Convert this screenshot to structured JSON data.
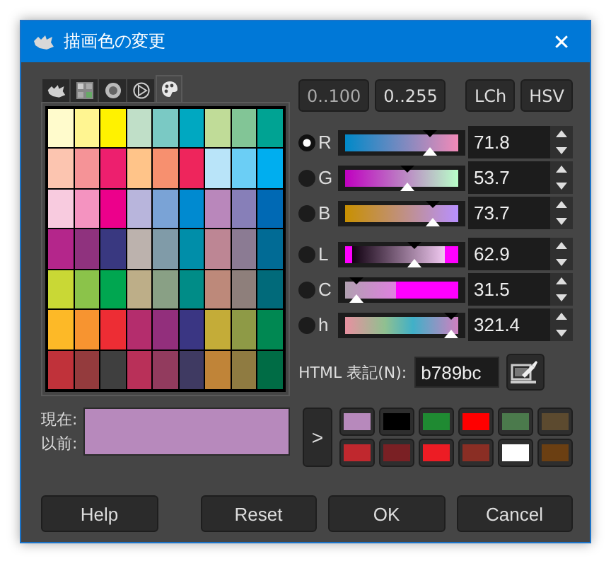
{
  "window": {
    "title": "描画色の変更",
    "close": "✕"
  },
  "selector_tabs": [
    {
      "selected": false
    },
    {
      "selected": false
    },
    {
      "selected": false
    },
    {
      "selected": false
    },
    {
      "selected": true
    }
  ],
  "palette": [
    {
      "color": "#fffbcc"
    },
    {
      "color": "#fff591"
    },
    {
      "color": "#fff200"
    },
    {
      "color": "#c0dfc8"
    },
    {
      "color": "#7ac9c4"
    },
    {
      "color": "#00a8c1"
    },
    {
      "color": "#c0dc98"
    },
    {
      "color": "#82c596"
    },
    {
      "color": "#00a393"
    },
    {
      "color": "#fcc5b0"
    },
    {
      "color": "#f59397"
    },
    {
      "color": "#ed1f6e"
    },
    {
      "color": "#ffc489"
    },
    {
      "color": "#f7906f"
    },
    {
      "color": "#ee255c"
    },
    {
      "color": "#b9e4f9"
    },
    {
      "color": "#6bcef5"
    },
    {
      "color": "#00aeef"
    },
    {
      "color": "#f8cbdf"
    },
    {
      "color": "#f493c0"
    },
    {
      "color": "#ec008b"
    },
    {
      "color": "#b8b5dc"
    },
    {
      "color": "#7aa3d6"
    },
    {
      "color": "#008ad0"
    },
    {
      "color": "#b987bb"
    },
    {
      "color": "#877fb8"
    },
    {
      "color": "#0069b4"
    },
    {
      "color": "#b4268b"
    },
    {
      "color": "#8f327e"
    },
    {
      "color": "#393880"
    },
    {
      "color": "#bcb2ad"
    },
    {
      "color": "#809ba8"
    },
    {
      "color": "#008ea9"
    },
    {
      "color": "#bd8694"
    },
    {
      "color": "#8b7b93"
    },
    {
      "color": "#016b95"
    },
    {
      "color": "#c9d835"
    },
    {
      "color": "#8bc34a"
    },
    {
      "color": "#00a650"
    },
    {
      "color": "#bdae88"
    },
    {
      "color": "#89a085"
    },
    {
      "color": "#008c87"
    },
    {
      "color": "#bd897a"
    },
    {
      "color": "#8e7f7b"
    },
    {
      "color": "#016a7a"
    },
    {
      "color": "#fdb927"
    },
    {
      "color": "#f79430"
    },
    {
      "color": "#ed2d34"
    },
    {
      "color": "#b42d6d"
    },
    {
      "color": "#922f7c"
    },
    {
      "color": "#3a3683"
    },
    {
      "color": "#c4ac38"
    },
    {
      "color": "#8e9a46"
    },
    {
      "color": "#008852"
    },
    {
      "color": "#c0323a"
    },
    {
      "color": "#943b3d"
    },
    {
      "color": "#3f3f3f"
    },
    {
      "color": "#b93059"
    },
    {
      "color": "#923b5e"
    },
    {
      "color": "#3f3a62"
    },
    {
      "color": "#c08438"
    },
    {
      "color": "#8f7b41"
    },
    {
      "color": "#006c45"
    }
  ],
  "range_buttons": [
    {
      "label": "0..100",
      "selected": true
    },
    {
      "label": "0..255",
      "selected": false
    }
  ],
  "model_buttons": [
    {
      "label": "LCh"
    },
    {
      "label": "HSV"
    }
  ],
  "channels": [
    {
      "label": "R",
      "selected": true,
      "level": 0.72,
      "value": "71.8"
    },
    {
      "label": "G",
      "selected": false,
      "level": 0.54,
      "value": "53.7"
    },
    {
      "label": "B",
      "selected": false,
      "level": 0.74,
      "value": "73.7"
    },
    {
      "label": "L",
      "selected": false,
      "level": 0.6,
      "value": "62.9"
    },
    {
      "label": "C",
      "selected": false,
      "level": 0.14,
      "value": "31.5"
    },
    {
      "label": "h",
      "selected": false,
      "level": 0.89,
      "value": "321.4"
    }
  ],
  "html_notation": {
    "label": "HTML 表記(N):",
    "value": "b789bc"
  },
  "current": {
    "label": "現在:",
    "color": "#b789bc"
  },
  "previous": {
    "label": "以前:",
    "color": "#b789bc"
  },
  "history_button": ">",
  "history": [
    {
      "color": "#b789bc"
    },
    {
      "color": "#000000"
    },
    {
      "color": "#1f8a32"
    },
    {
      "color": "#ff0000"
    },
    {
      "color": "#4b7a4c"
    },
    {
      "color": "#5c4a2f"
    },
    {
      "color": "#c0282e"
    },
    {
      "color": "#7a2024"
    },
    {
      "color": "#ed1c24"
    },
    {
      "color": "#8a2e24"
    },
    {
      "color": "#ffffff"
    },
    {
      "color": "#6b3f12"
    }
  ],
  "buttons": [
    "Help",
    "Reset",
    "OK",
    "Cancel"
  ]
}
